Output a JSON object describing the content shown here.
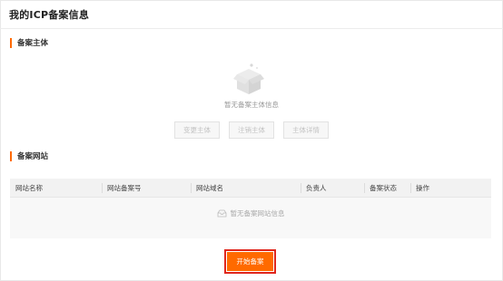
{
  "page": {
    "title": "我的ICP备案信息"
  },
  "subject_section": {
    "title": "备案主体",
    "empty_text": "暂无备案主体信息",
    "buttons": [
      {
        "label": "变更主体"
      },
      {
        "label": "注销主体"
      },
      {
        "label": "主体详情"
      }
    ]
  },
  "website_section": {
    "title": "备案网站",
    "columns": [
      "网站名称",
      "网站备案号",
      "网站域名",
      "负责人",
      "备案状态",
      "操作"
    ],
    "empty_text": "暂无备案网站信息"
  },
  "actions": {
    "start_label": "开始备案"
  },
  "colors": {
    "accent": "#ff6a00",
    "highlight": "#e0261c"
  }
}
